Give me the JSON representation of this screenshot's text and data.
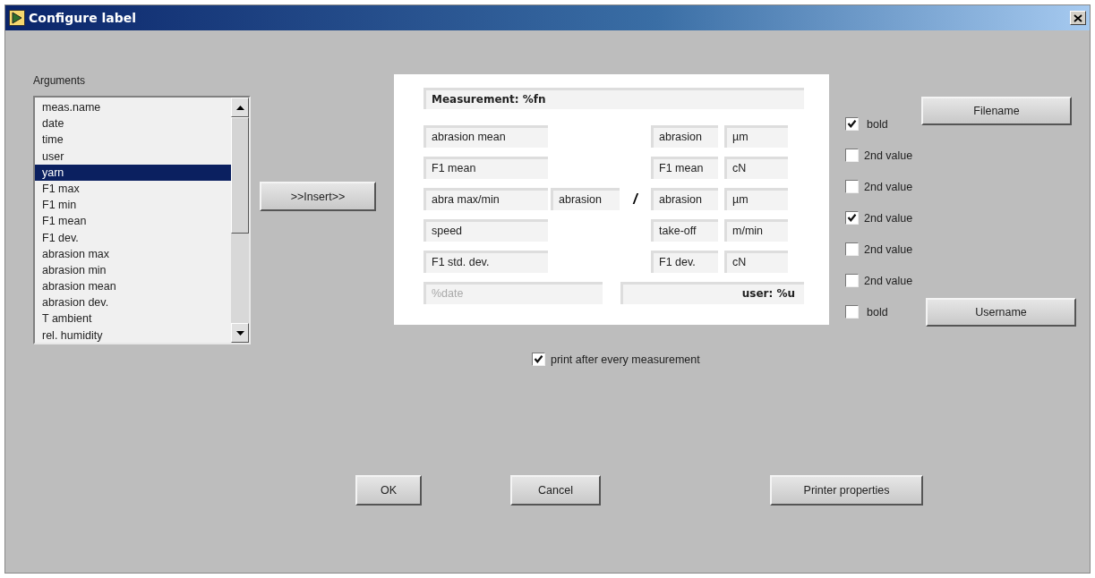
{
  "window": {
    "title": "Configure label"
  },
  "arguments": {
    "label": "Arguments",
    "items": [
      {
        "text": "meas.name",
        "selected": false
      },
      {
        "text": "date",
        "selected": false
      },
      {
        "text": "time",
        "selected": false
      },
      {
        "text": "user",
        "selected": false
      },
      {
        "text": "yarn",
        "selected": true
      },
      {
        "text": "F1 max",
        "selected": false
      },
      {
        "text": "F1 min",
        "selected": false
      },
      {
        "text": "F1 mean",
        "selected": false
      },
      {
        "text": "F1 dev.",
        "selected": false
      },
      {
        "text": "abrasion max",
        "selected": false
      },
      {
        "text": "abrasion min",
        "selected": false
      },
      {
        "text": "abrasion mean",
        "selected": false
      },
      {
        "text": "abrasion dev.",
        "selected": false
      },
      {
        "text": "T ambient",
        "selected": false
      },
      {
        "text": "rel. humidity",
        "selected": false
      }
    ]
  },
  "insert_button": ">>Insert>>",
  "label_preview": {
    "header": "Measurement: %fn",
    "rows": [
      {
        "caption": "abrasion mean",
        "value_name": "abrasion",
        "unit": "µm"
      },
      {
        "caption": "F1 mean",
        "value_name": "F1 mean",
        "unit": "cN"
      },
      {
        "caption": "abra max/min",
        "second_name": "abrasion",
        "separator": "/",
        "value_name": "abrasion",
        "unit": "µm"
      },
      {
        "caption": "speed",
        "value_name": "take-off",
        "unit": "m/min"
      },
      {
        "caption": "F1 std. dev.",
        "value_name": "F1 dev.",
        "unit": "cN"
      }
    ],
    "date": {
      "text": "%date",
      "disabled": true
    },
    "user": "user: %u"
  },
  "print_after_every_measurement": {
    "label": "print after every measurement",
    "checked": true
  },
  "options": [
    {
      "kind": "bold",
      "label": "bold",
      "checked": true,
      "button": "Filename"
    },
    {
      "kind": "second",
      "label": "2nd value",
      "checked": false
    },
    {
      "kind": "second",
      "label": "2nd value",
      "checked": false
    },
    {
      "kind": "second",
      "label": "2nd value",
      "checked": true
    },
    {
      "kind": "second",
      "label": "2nd value",
      "checked": false
    },
    {
      "kind": "second",
      "label": "2nd value",
      "checked": false
    },
    {
      "kind": "bold",
      "label": "bold",
      "checked": false,
      "button": "Username"
    }
  ],
  "buttons": [
    "OK",
    "Cancel",
    "Printer properties"
  ]
}
